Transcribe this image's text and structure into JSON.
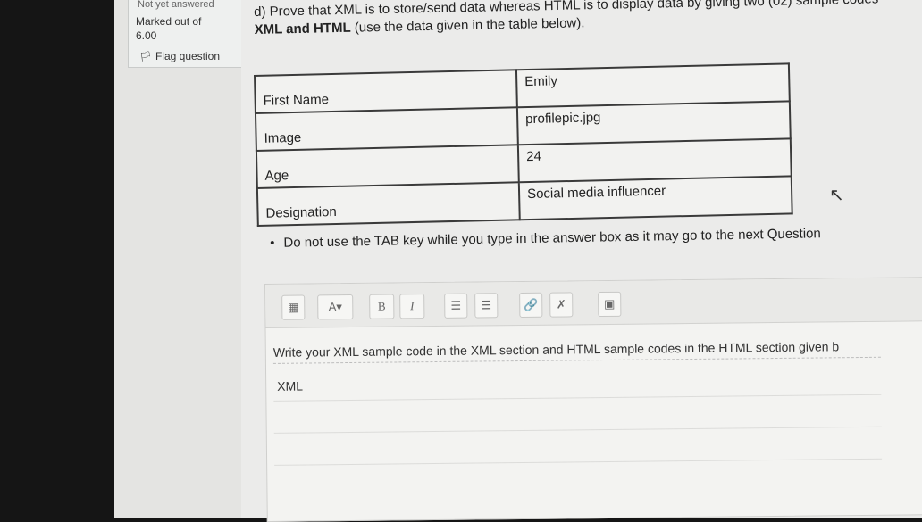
{
  "info": {
    "status": "Not yet answered",
    "marked_label": "Marked out of",
    "marked_value": "6.00",
    "flag_label": "Flag question"
  },
  "question": {
    "line1": "d) Prove that XML is to store/send data whereas HTML is to display data by giving two (02) sample codes",
    "line2_pre": "XML and ",
    "line2_bold": "HTML",
    "line2_post": " (use the data given in the table below)."
  },
  "table": {
    "rows": [
      {
        "label": "First Name",
        "value": "Emily"
      },
      {
        "label": "Image",
        "value": "profilepic.jpg"
      },
      {
        "label": "Age",
        "value": "24"
      },
      {
        "label": "Designation",
        "value": "Social media influencer"
      }
    ]
  },
  "instruction": "Do not use the TAB key while you type in the answer box as it may go to the next Question",
  "toolbar": {
    "bold": "B",
    "italic": "I",
    "font_color": "A"
  },
  "editor": {
    "line1": "Write your XML sample code in the XML section and HTML sample codes in the HTML section given b",
    "line2": "XML"
  },
  "icons": [
    "flag-icon",
    "toolbar-toggle-icon",
    "font-color-icon",
    "bold-icon",
    "italic-icon",
    "bullet-list-icon",
    "numbered-list-icon",
    "link-icon",
    "unlink-icon",
    "image-icon",
    "mouse-cursor-icon"
  ]
}
